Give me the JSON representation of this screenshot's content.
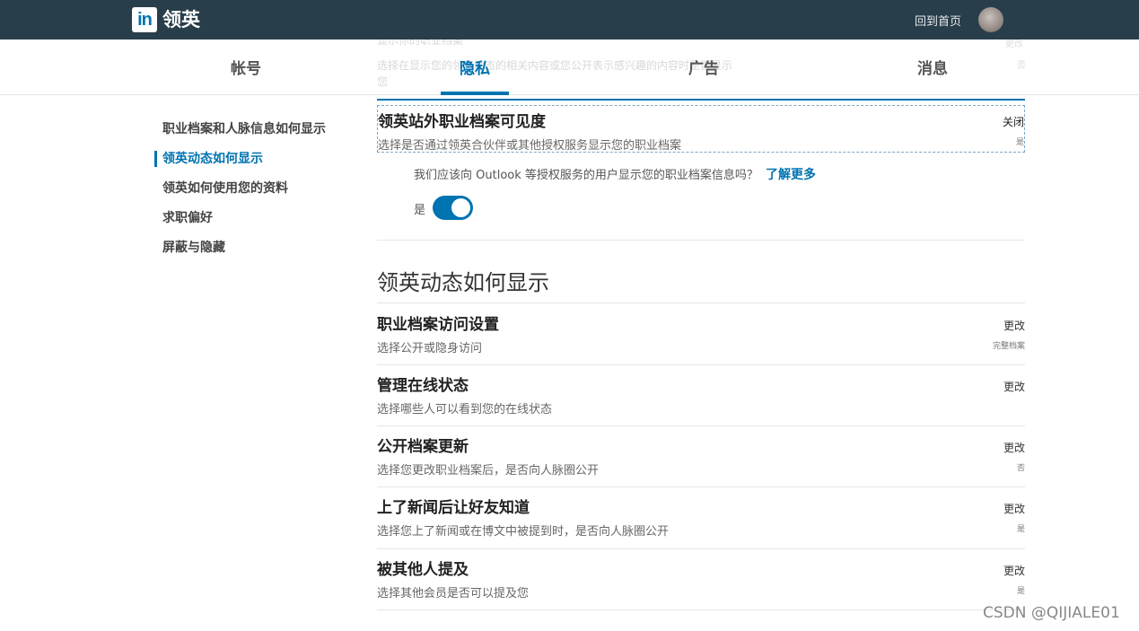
{
  "nav": {
    "logo_mark": "in",
    "logo_text": "领英",
    "home_link": "回到首页"
  },
  "faded_background": {
    "line1": "显示你的职业档案",
    "line2": "选择在显示您的领英动态的相关内容或您公开表示感兴趣的内容时是否显示",
    "line3": "您",
    "right1": "更改",
    "right2": "否"
  },
  "tabs": [
    {
      "label": "帐号"
    },
    {
      "label": "隐私"
    },
    {
      "label": "广告"
    },
    {
      "label": "消息"
    }
  ],
  "active_tab": "隐私",
  "sidebar": {
    "items": [
      {
        "label": "职业档案和人脉信息如何显示"
      },
      {
        "label": "领英动态如何显示"
      },
      {
        "label": "领英如何使用您的资料"
      },
      {
        "label": "求职偏好"
      },
      {
        "label": "屏蔽与隐藏"
      }
    ]
  },
  "expanded_setting": {
    "title": "领英站外职业档案可见度",
    "description": "选择是否通过领英合伙伴或其他授权服务显示您的职业档案",
    "action": "关闭",
    "value": "是",
    "question": "我们应该向 Outlook 等授权服务的用户显示您的职业档案信息吗？",
    "learn_more": "了解更多",
    "toggle_label": "是",
    "toggle_on": true
  },
  "section": {
    "heading": "领英动态如何显示",
    "rows": [
      {
        "title": "职业档案访问设置",
        "description": "选择公开或隐身访问",
        "action": "更改",
        "value": "完整档案"
      },
      {
        "title": "管理在线状态",
        "description": "选择哪些人可以看到您的在线状态",
        "action": "更改",
        "value": ""
      },
      {
        "title": "公开档案更新",
        "description": "选择您更改职业档案后，是否向人脉圈公开",
        "action": "更改",
        "value": "否"
      },
      {
        "title": "上了新闻后让好友知道",
        "description": "选择您上了新闻或在博文中被提到时，是否向人脉圈公开",
        "action": "更改",
        "value": "是"
      },
      {
        "title": "被其他人提及",
        "description": "选择其他会员是否可以提及您",
        "action": "更改",
        "value": "是"
      }
    ]
  },
  "watermark": "CSDN @QIJIALE01",
  "colors": {
    "topbar": "#283e4a",
    "accent": "#0073b1"
  }
}
